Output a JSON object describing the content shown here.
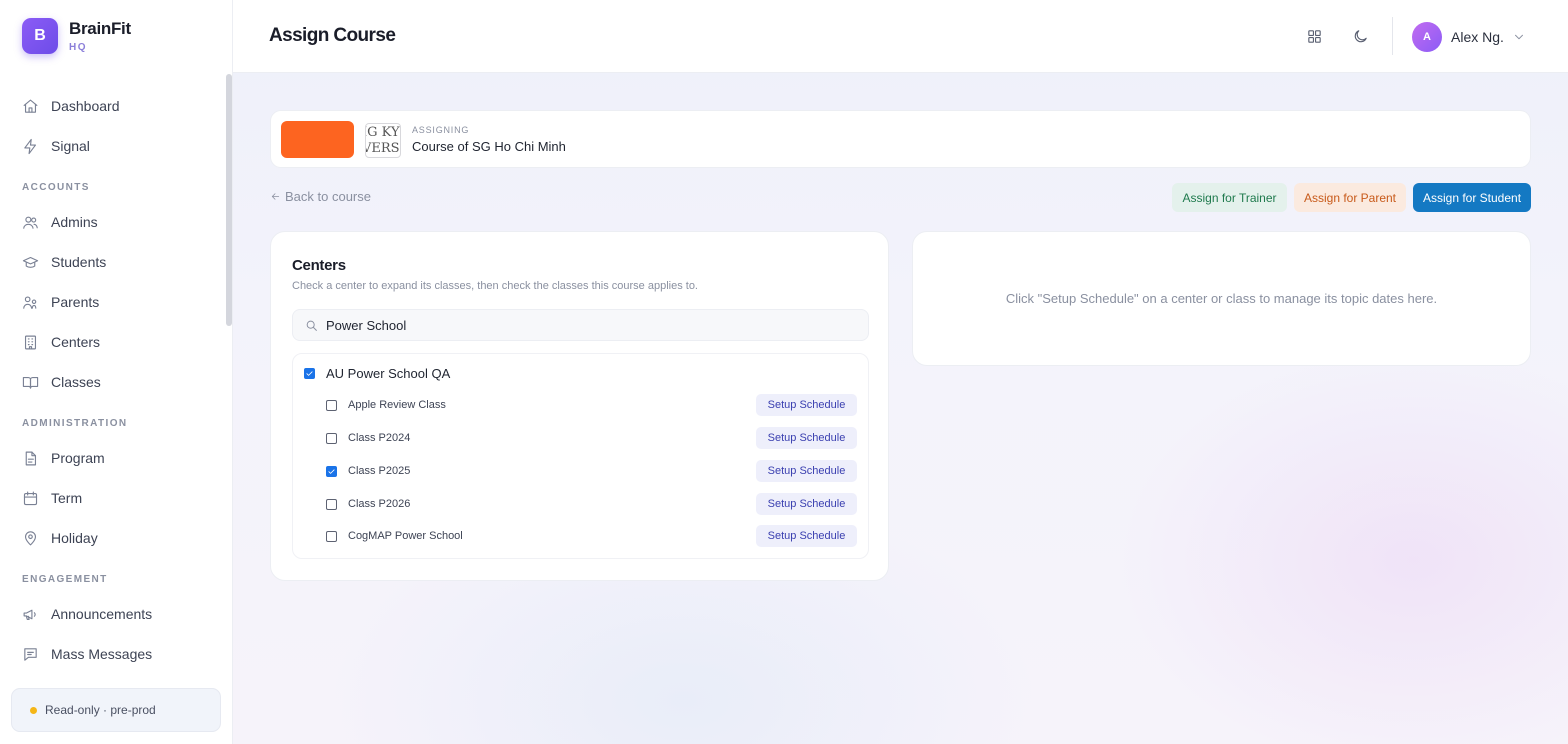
{
  "brand": {
    "logo_letter": "B",
    "name": "BrainFit",
    "sub": "HQ"
  },
  "sidebar": {
    "items": [
      {
        "label": "Dashboard",
        "icon": "home-icon"
      },
      {
        "label": "Signal",
        "icon": "bolt-icon"
      }
    ],
    "sections": [
      {
        "title": "ACCOUNTS",
        "items": [
          {
            "label": "Admins",
            "icon": "users-icon"
          },
          {
            "label": "Students",
            "icon": "graduation-cap-icon"
          },
          {
            "label": "Parents",
            "icon": "parents-icon"
          },
          {
            "label": "Centers",
            "icon": "building-icon"
          },
          {
            "label": "Classes",
            "icon": "book-open-icon"
          }
        ]
      },
      {
        "title": "ADMINISTRATION",
        "items": [
          {
            "label": "Program",
            "icon": "file-icon"
          },
          {
            "label": "Term",
            "icon": "calendar-icon"
          },
          {
            "label": "Holiday",
            "icon": "map-pin-icon"
          }
        ]
      },
      {
        "title": "ENGAGEMENT",
        "items": [
          {
            "label": "Announcements",
            "icon": "megaphone-icon"
          },
          {
            "label": "Mass Messages",
            "icon": "message-icon"
          }
        ]
      }
    ],
    "env_badge": "Read-only · pre-prod",
    "env_color": "#f5b617"
  },
  "header": {
    "title": "Assign Course",
    "user_initial": "A",
    "user_name": "Alex Ng."
  },
  "course": {
    "assigning_label": "ASSIGNING",
    "name": "Course of SG Ho Chi Minh",
    "logo_line1": "IG KYU",
    "logo_line2": "VERSI",
    "thumb_color": "#fd6420"
  },
  "actions": {
    "back_label": "Back to course",
    "assign_trainer": "Assign for Trainer",
    "assign_parent": "Assign for Parent",
    "assign_student": "Assign for Student"
  },
  "centers": {
    "title": "Centers",
    "hint": "Check a center to expand its classes, then check the classes this course applies to.",
    "search_value": "Power School",
    "setup_label": "Setup Schedule",
    "list": [
      {
        "name": "AU Power School QA",
        "checked": true,
        "classes": [
          {
            "name": "Apple Review Class",
            "checked": false
          },
          {
            "name": "Class P2024",
            "checked": false
          },
          {
            "name": "Class P2025",
            "checked": true
          },
          {
            "name": "Class P2026",
            "checked": false
          },
          {
            "name": "CogMAP Power School",
            "checked": false
          }
        ]
      }
    ]
  },
  "schedule": {
    "hint": "Click \"Setup Schedule\" on a center or class to manage its topic dates here."
  },
  "colors": {
    "accent": "#6d4ce8",
    "primary_button": "#1479c3",
    "checkbox": "#1a73e8"
  }
}
